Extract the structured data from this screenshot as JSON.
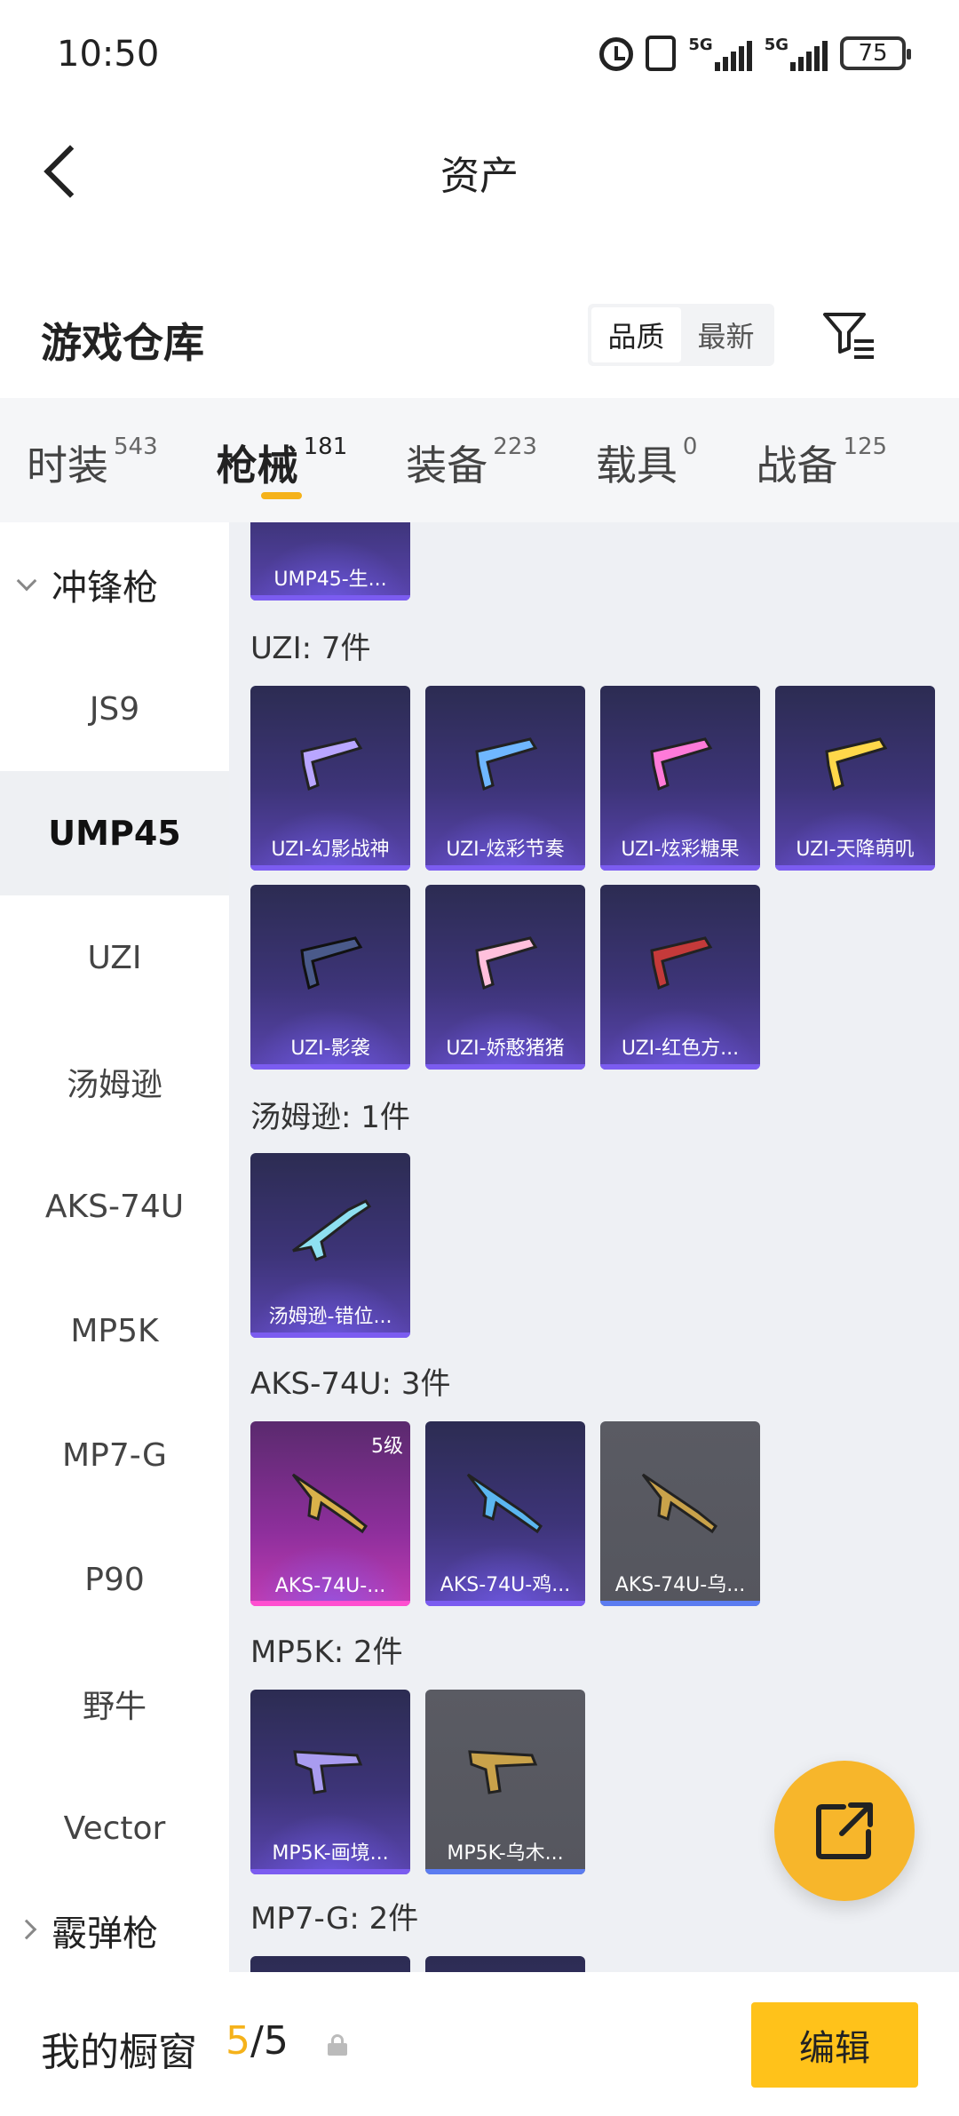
{
  "status_bar": {
    "time": "10:50",
    "network_1": "5G",
    "network_2": "5G",
    "battery": "75"
  },
  "header": {
    "title": "资产"
  },
  "section": {
    "title": "游戏仓库",
    "sort_options": [
      "品质",
      "最新"
    ],
    "active_sort": "品质"
  },
  "tabs": [
    {
      "label": "时装",
      "count": "543"
    },
    {
      "label": "枪械",
      "count": "181"
    },
    {
      "label": "装备",
      "count": "223"
    },
    {
      "label": "载具",
      "count": "0"
    },
    {
      "label": "战备",
      "count": "125"
    }
  ],
  "active_tab": "枪械",
  "sidebar": {
    "group_expanded": "冲锋枪",
    "items": [
      "JS9",
      "UMP45",
      "UZI",
      "汤姆逊",
      "AKS-74U",
      "MP5K",
      "MP7-G",
      "P90",
      "野牛",
      "Vector"
    ],
    "active_item": "UMP45",
    "group_collapsed": "霰弹枪"
  },
  "content": {
    "top_partial_card": "UMP45-生...",
    "groups": [
      {
        "label": "UZI: 7件",
        "items": [
          "UZI-幻影战神",
          "UZI-炫彩节奏",
          "UZI-炫彩糖果",
          "UZI-天降萌叽",
          "UZI-影袭",
          "UZI-娇憨猪猪",
          "UZI-红色方..."
        ]
      },
      {
        "label": "汤姆逊: 1件",
        "items": [
          "汤姆逊-错位..."
        ]
      },
      {
        "label": "AKS-74U: 3件",
        "items": [
          "AKS-74U-...",
          "AKS-74U-鸡...",
          "AKS-74U-乌..."
        ],
        "level_badge": "5级"
      },
      {
        "label": "MP5K: 2件",
        "items": [
          "MP5K-画境...",
          "MP5K-乌木..."
        ]
      },
      {
        "label": "MP7-G: 2件",
        "items": []
      }
    ]
  },
  "footer": {
    "shop_label": "我的橱窗",
    "shop_current": "5",
    "shop_separator": "/",
    "shop_total": "5",
    "edit_label": "编辑"
  },
  "colors": {
    "accent": "#f5b21a",
    "card_purple": "#3d3478",
    "card_grey": "#55565e",
    "card_pink": "#8e2f9c",
    "content_bg": "#eef0f4"
  }
}
